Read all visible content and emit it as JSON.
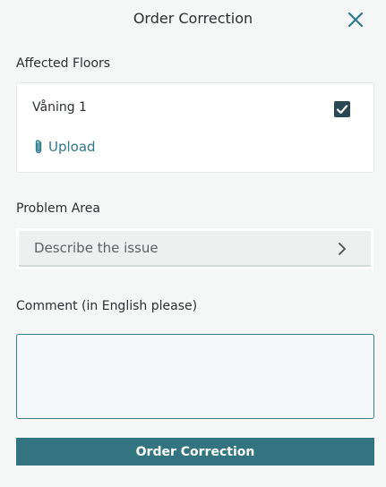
{
  "header": {
    "title": "Order Correction",
    "close_icon": "close-icon"
  },
  "affected_floors": {
    "label": "Affected Floors",
    "floors": [
      {
        "name": "Våning 1",
        "checked": true
      }
    ],
    "upload_label": "Upload",
    "upload_icon": "paperclip-icon"
  },
  "problem_area": {
    "label": "Problem Area",
    "placeholder": "Describe the issue",
    "chevron_icon": "chevron-right-icon"
  },
  "comment": {
    "label": "Comment (in English please)",
    "value": ""
  },
  "submit": {
    "label": "Order Correction"
  },
  "colors": {
    "accent": "#327581",
    "link": "#2f7a8a",
    "checkbox": "#2a4754",
    "background": "#f5f7f7"
  }
}
